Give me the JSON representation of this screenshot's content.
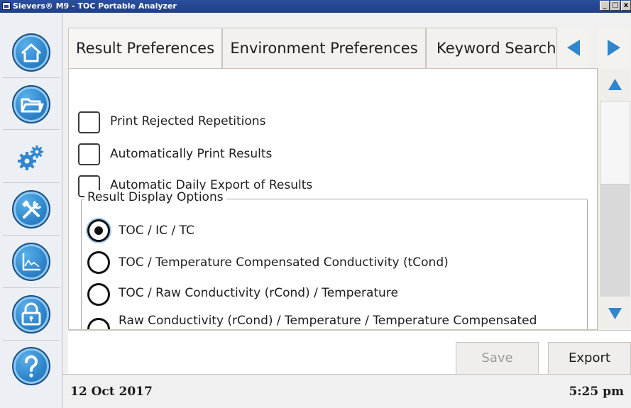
{
  "window": {
    "title": "Sievers® M9 - TOC Portable Analyzer",
    "controls": [
      "_",
      "□",
      "x"
    ]
  },
  "sidebar": {
    "items": [
      {
        "name": "home",
        "icon": "home-icon"
      },
      {
        "name": "data",
        "icon": "folder-icon"
      },
      {
        "name": "setup",
        "icon": "gears-icon",
        "active": true
      },
      {
        "name": "maintenance",
        "icon": "tools-icon"
      },
      {
        "name": "calibration",
        "icon": "chart-icon"
      },
      {
        "name": "security",
        "icon": "lock-icon"
      },
      {
        "name": "help",
        "icon": "help-icon"
      }
    ]
  },
  "tabs": {
    "items": [
      {
        "label": "Result Preferences",
        "active": true
      },
      {
        "label": "Environment Preferences"
      },
      {
        "label": "Keyword Search"
      }
    ],
    "prev_icon": "triangle-left-icon",
    "next_icon": "triangle-right-icon"
  },
  "options": {
    "checkboxes": [
      {
        "label": "Print Rejected Repetitions",
        "checked": false
      },
      {
        "label": "Automatically Print Results",
        "checked": false
      },
      {
        "label": "Automatic Daily Export of Results",
        "checked": false
      }
    ],
    "display_group": {
      "legend": "Result Display Options",
      "radios": [
        {
          "label": "TOC / IC / TC",
          "selected": true
        },
        {
          "label": "TOC / Temperature Compensated Conductivity (tCond)",
          "selected": false
        },
        {
          "label": "TOC / Raw Conductivity (rCond) / Temperature",
          "selected": false
        },
        {
          "label": "Raw Conductivity (rCond) / Temperature / Temperature Compensated",
          "selected": false
        }
      ]
    }
  },
  "actions": {
    "save_label": "Save",
    "export_label": "Export"
  },
  "status": {
    "date": "12 Oct 2017",
    "time": "5:25 pm"
  },
  "colors": {
    "accent": "#2f86cc",
    "titlebar": "#2b4f9e",
    "radio_focus": "#9ec9ee"
  }
}
